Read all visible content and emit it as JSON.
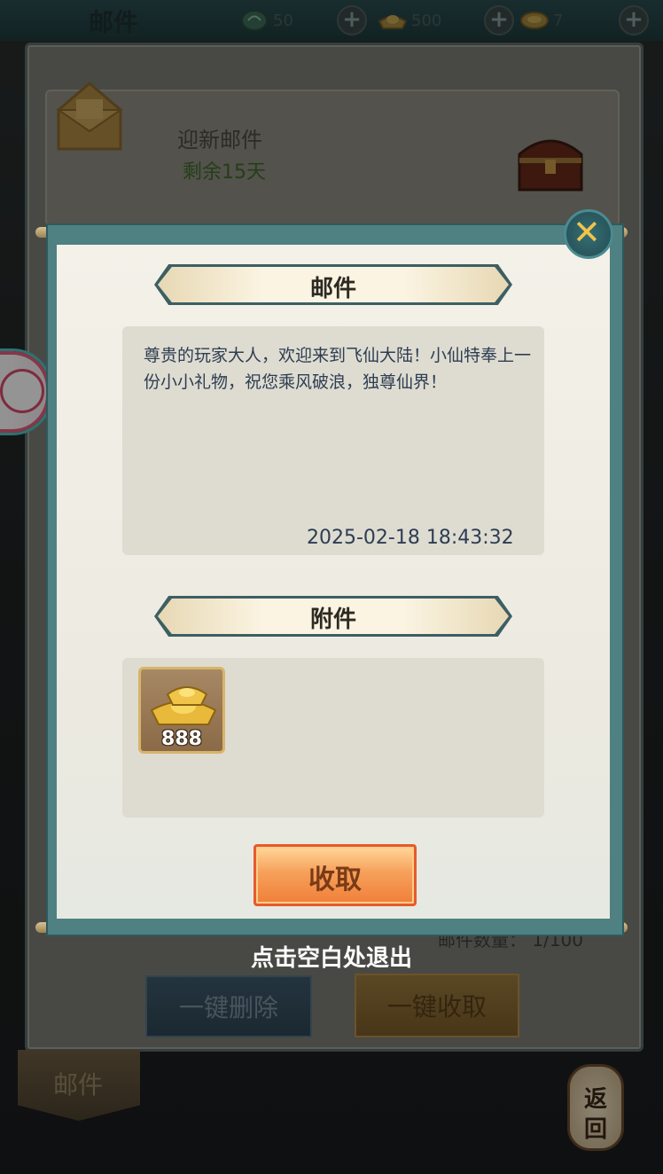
{
  "topbar": {
    "title": "邮件",
    "currencies": [
      {
        "icon": "jade-coin-icon",
        "value": "50"
      },
      {
        "icon": "gold-ingot-icon",
        "value": "500"
      },
      {
        "icon": "coin-icon",
        "value": "7"
      }
    ]
  },
  "background": {
    "mail_item": {
      "title": "迎新邮件",
      "remaining": "剩余15天"
    },
    "mail_count": "邮件数量： 1/100",
    "delete_all_label": "一键删除",
    "collect_all_label": "一键收取",
    "bottom_tab_label": "邮件",
    "return_label_top": "返",
    "return_label_bottom": "回"
  },
  "modal": {
    "header": "邮件",
    "message": "尊贵的玩家大人，欢迎来到飞仙大陆！小仙特奉上一份小小礼物，祝您乘风破浪，独尊仙界！",
    "date": "2025-02-18 18:43:32",
    "attachments_header": "附件",
    "attachments": [
      {
        "icon": "gold-ingot-icon",
        "count": "888"
      }
    ],
    "claim_label": "收取"
  },
  "exit_hint": "点击空白处退出",
  "colors": {
    "modal_frame": "#4f8082",
    "paper": "#f3f1e8",
    "text": "#2e3d52",
    "claim_button": "#f07f3a",
    "close_x": "#f1c44a"
  }
}
